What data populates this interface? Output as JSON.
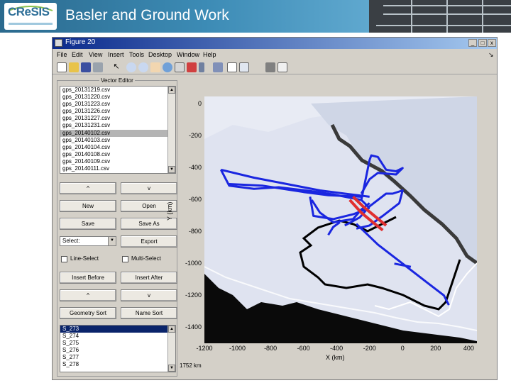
{
  "slide": {
    "title": "Basler and Ground Work",
    "logo_text": "CReSIS"
  },
  "window": {
    "title": "Figure 20",
    "controls": [
      "_",
      "□",
      "x"
    ]
  },
  "menu": {
    "items": [
      "File",
      "Edit",
      "View",
      "Insert",
      "Tools",
      "Desktop",
      "Window",
      "Help"
    ]
  },
  "editor": {
    "group_label": "Vector Editor",
    "files": [
      "gps_20131219.csv",
      "gps_20131220.csv",
      "gps_20131223.csv",
      "gps_20131226.csv",
      "gps_20131227.csv",
      "gps_20131231.csv",
      "gps_20140102.csv",
      "gps_20140103.csv",
      "gps_20140104.csv",
      "gps_20140108.csv",
      "gps_20140109.csv",
      "gps_20140111.csv"
    ],
    "selected_file": "gps_20140102.csv",
    "buttons": {
      "up": "^",
      "down": "v",
      "new": "New",
      "open": "Open",
      "save": "Save",
      "save_as": "Save As",
      "export": "Export",
      "insert_before": "Insert Before",
      "insert_after": "Insert After",
      "up2": "^",
      "down2": "v",
      "geometry_sort": "Geometry Sort",
      "name_sort": "Name Sort"
    },
    "select_value": "Select:",
    "line_select": "Line-Select",
    "multi_select": "Multi-Select",
    "segments": [
      "S_273",
      "S_274",
      "S_275",
      "S_276",
      "S_277",
      "S_278"
    ],
    "selected_segment": "S_273",
    "length_text": "1752 km"
  },
  "plot": {
    "ylabel": "Y (km)",
    "xlabel": "X (km)",
    "yticks": [
      "0",
      "-200",
      "-400",
      "-600",
      "-800",
      "-1000",
      "-1200",
      "-1400"
    ],
    "xticks": [
      "-1200",
      "-1000",
      "-800",
      "-600",
      "-400",
      "-200",
      "0",
      "200",
      "400"
    ]
  },
  "chart_data": {
    "type": "line",
    "xlabel": "X (km)",
    "ylabel": "Y (km)",
    "xlim": [
      -1200,
      450
    ],
    "ylim": [
      -1500,
      50
    ],
    "xticks": [
      -1200,
      -1000,
      -800,
      -600,
      -400,
      -200,
      0,
      200,
      400
    ],
    "yticks": [
      0,
      -200,
      -400,
      -600,
      -800,
      -1000,
      -1200,
      -1400
    ],
    "background": "satellite imagery of ice shelf with coastline",
    "series": [
      {
        "color": "#1a26e0",
        "paths": [
          [
            [
              -1100,
              -410
            ],
            [
              -1050,
              -510
            ],
            [
              -900,
              -530
            ],
            [
              -750,
              -520
            ],
            [
              -550,
              -545
            ],
            [
              -420,
              -565
            ],
            [
              -300,
              -590
            ],
            [
              -250,
              -600
            ],
            [
              -200,
              -650
            ]
          ],
          [
            [
              -1100,
              -410
            ],
            [
              -900,
              -460
            ],
            [
              -700,
              -500
            ],
            [
              -500,
              -540
            ],
            [
              -350,
              -560
            ],
            [
              -200,
              -580
            ]
          ],
          [
            [
              -1050,
              -500
            ],
            [
              -850,
              -510
            ],
            [
              -600,
              -550
            ],
            [
              -450,
              -570
            ],
            [
              -250,
              -580
            ]
          ],
          [
            [
              -550,
              -600
            ],
            [
              -500,
              -680
            ],
            [
              -420,
              -740
            ],
            [
              -300,
              -720
            ],
            [
              -250,
              -660
            ],
            [
              -200,
              -620
            ]
          ],
          [
            [
              -560,
              -580
            ],
            [
              -540,
              -700
            ],
            [
              -420,
              -720
            ],
            [
              -300,
              -690
            ],
            [
              -200,
              -650
            ]
          ],
          [
            [
              -250,
              -600
            ],
            [
              -220,
              -450
            ],
            [
              -200,
              -350
            ],
            [
              -190,
              -320
            ],
            [
              -150,
              -330
            ],
            [
              -100,
              -410
            ],
            [
              -40,
              -420
            ],
            [
              0,
              -400
            ],
            [
              -40,
              -440
            ],
            [
              -150,
              -430
            ],
            [
              -200,
              -470
            ],
            [
              -250,
              -560
            ]
          ],
          [
            [
              -350,
              -760
            ],
            [
              -260,
              -710
            ],
            [
              -200,
              -640
            ],
            [
              -150,
              -600
            ],
            [
              -100,
              -560
            ],
            [
              -60,
              -560
            ],
            [
              0,
              -540
            ],
            [
              -20,
              -620
            ],
            [
              -120,
              -700
            ],
            [
              -200,
              -760
            ],
            [
              -280,
              -780
            ]
          ],
          [
            [
              -280,
              -750
            ],
            [
              -150,
              -880
            ],
            [
              0,
              -1000
            ],
            [
              150,
              -1120
            ],
            [
              250,
              -1200
            ],
            [
              280,
              -1260
            ]
          ],
          [
            [
              -50,
              -1000
            ],
            [
              50,
              -1020
            ]
          ],
          [
            [
              -450,
              -820
            ],
            [
              -420,
              -770
            ],
            [
              -380,
              -740
            ]
          ]
        ]
      },
      {
        "color": "#e03030",
        "paths": [
          [
            [
              -300,
              -580
            ],
            [
              -240,
              -640
            ],
            [
              -170,
              -700
            ],
            [
              -100,
              -760
            ]
          ],
          [
            [
              -320,
              -600
            ],
            [
              -250,
              -680
            ],
            [
              -180,
              -740
            ],
            [
              -120,
              -790
            ]
          ]
        ]
      }
    ]
  }
}
